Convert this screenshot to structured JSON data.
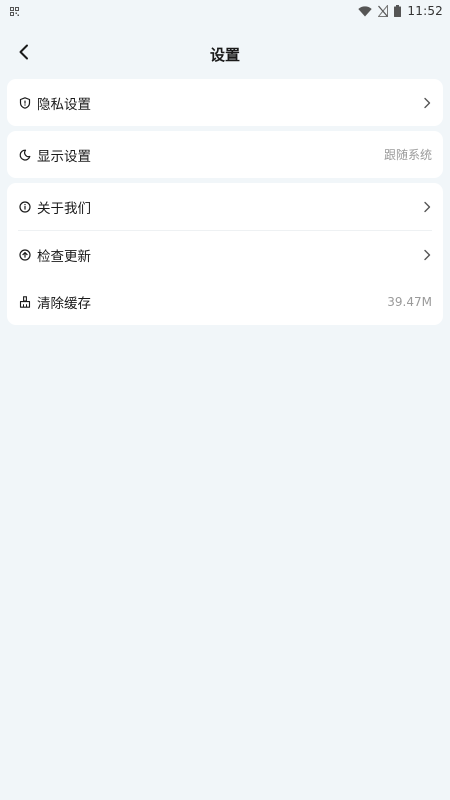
{
  "status_bar": {
    "time": "11:52",
    "icons": [
      "qr-icon",
      "wifi-icon",
      "no-signal-icon",
      "battery-icon"
    ]
  },
  "header": {
    "title": "设置",
    "back_icon": "back-arrow-icon"
  },
  "sections": [
    {
      "rows": [
        {
          "label": "隐私设置",
          "icon": "shield-icon",
          "value": "",
          "chevron": true
        }
      ]
    },
    {
      "rows": [
        {
          "label": "显示设置",
          "icon": "moon-icon",
          "value": "跟随系统",
          "chevron": false
        }
      ]
    },
    {
      "rows": [
        {
          "label": "关于我们",
          "icon": "info-icon",
          "value": "",
          "chevron": true
        },
        {
          "label": "检查更新",
          "icon": "upload-icon",
          "value": "",
          "chevron": true
        },
        {
          "label": "清除缓存",
          "icon": "broom-icon",
          "value": "39.47M",
          "chevron": false
        }
      ]
    }
  ],
  "colors": {
    "background": "#f1f6f9",
    "card": "#ffffff",
    "text": "#1a1a1a",
    "secondary_text": "#9a9a9a"
  }
}
